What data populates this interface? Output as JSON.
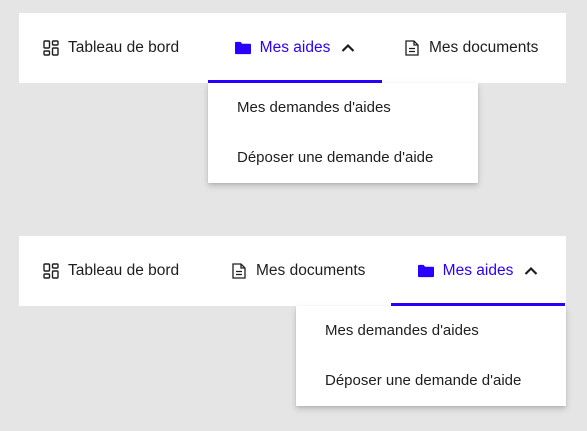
{
  "colors": {
    "accent": "#2a00ff",
    "text": "#1e1e1e",
    "background": "#e5e5e5",
    "panel": "#ffffff"
  },
  "nav_top": {
    "items": [
      {
        "label": "Tableau de bord",
        "icon": "dashboard-icon"
      },
      {
        "label": "Mes aides",
        "icon": "folder-icon",
        "active": true,
        "expanded": true
      },
      {
        "label": "Mes documents",
        "icon": "document-icon"
      }
    ],
    "dropdown": [
      "Mes demandes d'aides",
      "Déposer une demande d'aide"
    ]
  },
  "nav_bottom": {
    "items": [
      {
        "label": "Tableau de bord",
        "icon": "dashboard-icon"
      },
      {
        "label": "Mes documents",
        "icon": "document-icon"
      },
      {
        "label": "Mes aides",
        "icon": "folder-icon",
        "active": true,
        "expanded": true
      }
    ],
    "dropdown": [
      "Mes demandes d'aides",
      "Déposer une demande d'aide"
    ]
  }
}
